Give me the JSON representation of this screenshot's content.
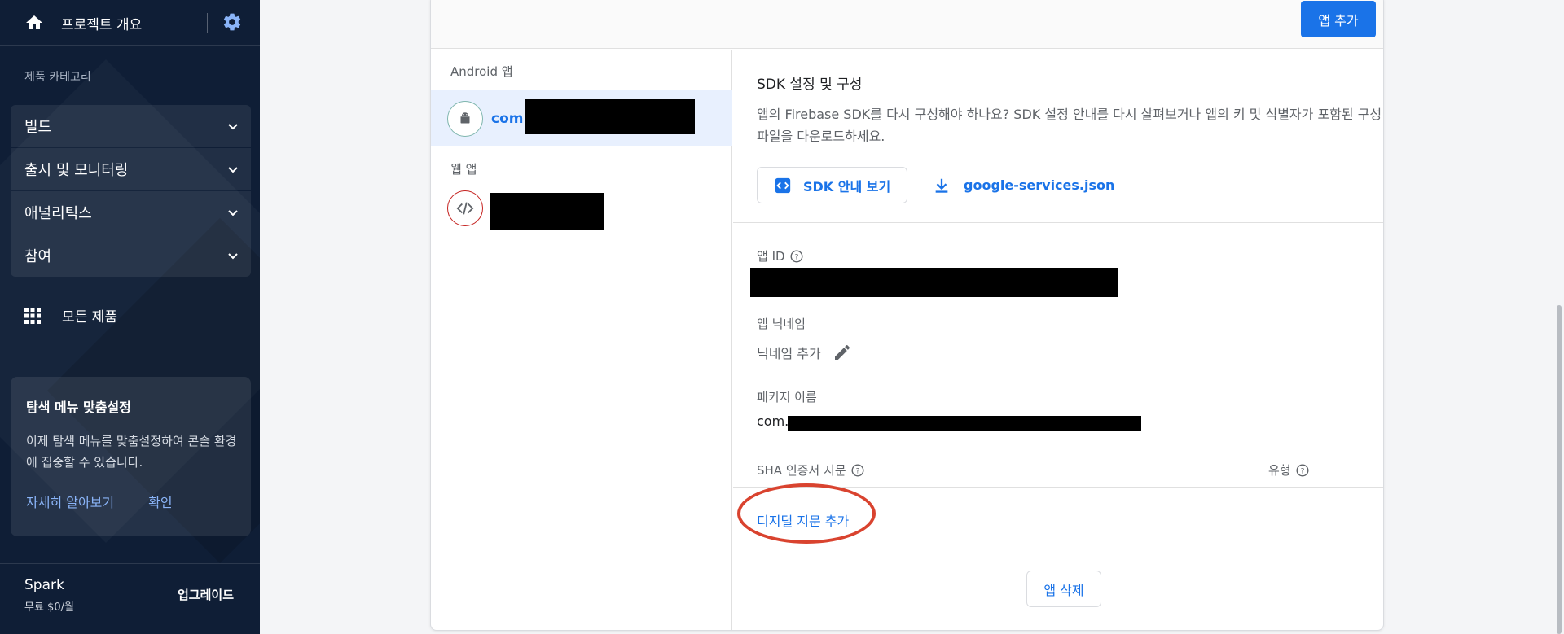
{
  "sidebar": {
    "project_overview": "프로젝트 개요",
    "category_label": "제품 카테고리",
    "nav_items": [
      {
        "label": "빌드"
      },
      {
        "label": "출시 및 모니터링"
      },
      {
        "label": "애널리틱스"
      },
      {
        "label": "참여"
      }
    ],
    "all_products": "모든 제품",
    "promo": {
      "title": "탐색 메뉴 맞춤설정",
      "text": "이제 탐색 메뉴를 맞춤설정하여 콘솔 환경에 집중할 수 있습니다.",
      "learn_more": "자세히 알아보기",
      "confirm": "확인"
    },
    "plan": {
      "name": "Spark",
      "price": "무료 $0/월",
      "upgrade": "업그레이드"
    }
  },
  "main": {
    "add_app": "앱 추가",
    "android_section": "Android 앱",
    "android_app_name": "com.a",
    "web_section": "웹 앱",
    "sdk": {
      "title": "SDK 설정 및 구성",
      "description": "앱의 Firebase SDK를 다시 구성해야 하나요? SDK 설정 안내를 다시 살펴보거나 앱의 키 및 식별자가 포함된 구성 파일을 다운로드하세요.",
      "guide_button": "SDK 안내 보기",
      "download_file": "google-services.json"
    },
    "app_id_label": "앱 ID",
    "nickname_label": "앱 닉네임",
    "nickname_value": "닉네임 추가",
    "package_label": "패키지 이름",
    "package_value": "com.",
    "sha_label": "SHA 인증서 지문",
    "type_label": "유형",
    "add_fingerprint": "디지털 지문 추가",
    "delete_app": "앱 삭제"
  },
  "colors": {
    "sidebar_bg": "#0f1e36",
    "accent": "#1a73e8",
    "highlight": "#d9432f"
  }
}
